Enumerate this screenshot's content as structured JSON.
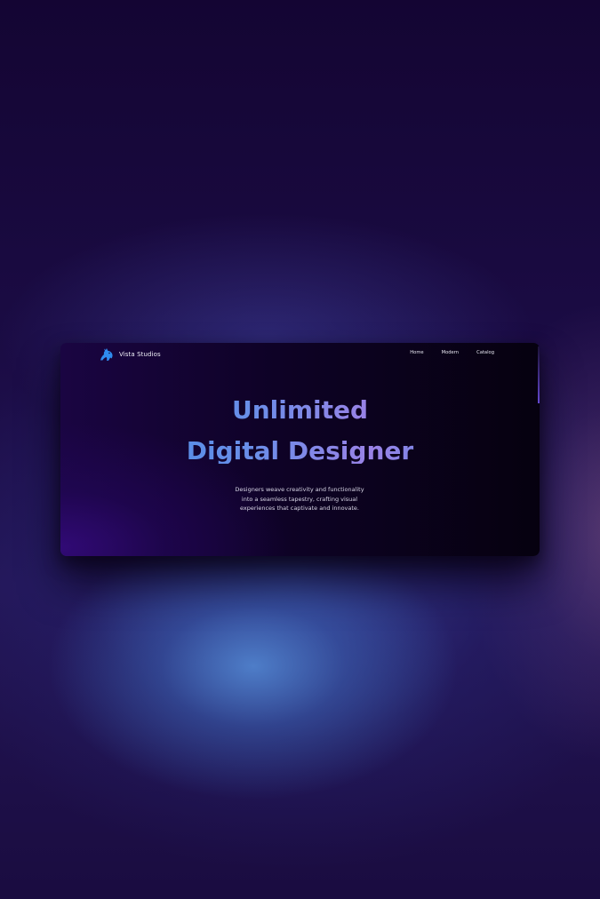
{
  "brand": {
    "name": "Vista Studios",
    "icon": "unicorn-icon",
    "icon_color": "#2f8cf0"
  },
  "nav": {
    "links": [
      "Home",
      "Modern",
      "Catalog"
    ]
  },
  "hero": {
    "title_line1": "Unlimited",
    "title_line2": "Digital Designer",
    "description": "Designers weave creativity and functionality into a seamless tapestry, crafting visual experiences that captivate and innovate."
  },
  "colors": {
    "title_gradient": [
      "#3c8fe6",
      "#9a82e6"
    ],
    "card_background": "#0e0226"
  }
}
